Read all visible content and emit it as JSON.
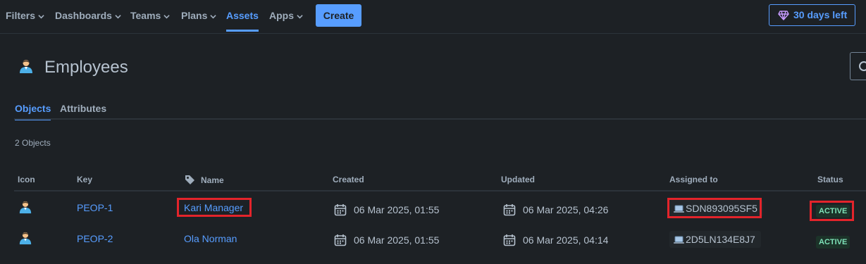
{
  "nav": {
    "items": [
      {
        "label": "Filters",
        "has_chevron": true
      },
      {
        "label": "Dashboards",
        "has_chevron": true
      },
      {
        "label": "Teams",
        "has_chevron": true
      },
      {
        "label": "Plans",
        "has_chevron": true
      },
      {
        "label": "Assets",
        "has_chevron": false,
        "active": true
      },
      {
        "label": "Apps",
        "has_chevron": true
      }
    ],
    "create_label": "Create",
    "trial_label": "30 days left",
    "trial_icon": "diamond-icon"
  },
  "page": {
    "title": "Employees",
    "icon": "person-icon",
    "tabs": [
      {
        "label": "Objects",
        "active": true
      },
      {
        "label": "Attributes",
        "active": false
      }
    ],
    "count_text": "2 Objects"
  },
  "table": {
    "columns": [
      "Icon",
      "Key",
      "Name",
      "Created",
      "Updated",
      "Assigned to",
      "Status"
    ],
    "rows": [
      {
        "key": "PEOP-1",
        "name": "Kari Manager",
        "created": "06 Mar 2025, 01:55",
        "updated": "06 Mar 2025, 04:26",
        "assigned_to": "SDN893095SF5",
        "status": "ACTIVE"
      },
      {
        "key": "PEOP-2",
        "name": "Ola Norman",
        "created": "06 Mar 2025, 01:55",
        "updated": "06 Mar 2025, 04:14",
        "assigned_to": "2D5LN134E8J7",
        "status": "ACTIVE"
      }
    ]
  },
  "colors": {
    "background": "#1d2125",
    "accent": "#579dff",
    "highlight": "#e3242b",
    "status_bg": "#1c3329",
    "status_text": "#7ee2b8"
  }
}
